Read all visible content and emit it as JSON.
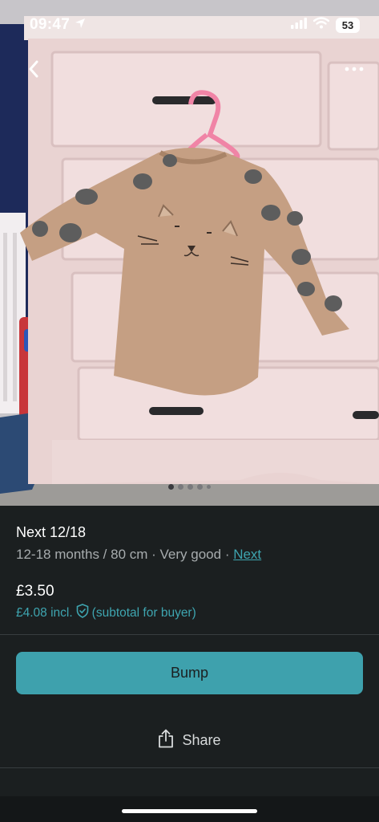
{
  "status_bar": {
    "time": "09:47",
    "battery": "53"
  },
  "photo": {
    "pagination": {
      "total": 5,
      "active_index": 0
    }
  },
  "item": {
    "title": "Next 12/18",
    "size": "12-18 months / 80 cm",
    "separator": " · ",
    "condition": "Very good",
    "brand": "Next",
    "price": "£3.50",
    "price_incl": "£4.08 incl.",
    "price_incl_note": "(subtotal for buyer)"
  },
  "actions": {
    "bump_label": "Bump",
    "share_label": "Share"
  },
  "colors": {
    "accent": "#3ea1ad",
    "background": "#1b1f20",
    "muted_text": "#a7acae"
  }
}
